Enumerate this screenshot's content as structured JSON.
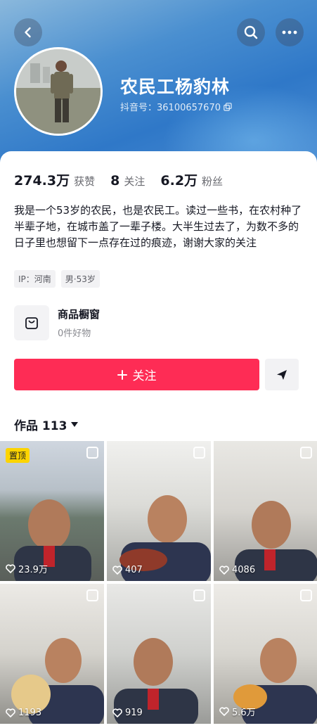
{
  "header": {
    "name": "农民工杨豹林",
    "douyin_id": "抖音号：36100657670"
  },
  "stats": [
    {
      "value": "274.3万",
      "label": "获赞"
    },
    {
      "value": "8",
      "label": "关注"
    },
    {
      "value": "6.2万",
      "label": "粉丝"
    }
  ],
  "bio": "我是一个53岁的农民，也是农民工。读过一些书，在农村种了半辈子地，在城市盖了一辈子楼。大半生过去了，为数不多的日子里也想留下一点存在过的痕迹，谢谢大家的关注",
  "tags": [
    "IP：河南",
    "男·53岁"
  ],
  "shop": {
    "title": "商品橱窗",
    "subtitle": "0件好物"
  },
  "follow_button": {
    "label": "关注"
  },
  "works_tab": {
    "label": "作品 113"
  },
  "videos": [
    {
      "likes": "23.9万",
      "pinned": "置顶"
    },
    {
      "likes": "407"
    },
    {
      "likes": "4086"
    },
    {
      "likes": "1193"
    },
    {
      "likes": "919"
    },
    {
      "likes": "5.6万"
    }
  ],
  "colors": {
    "accent": "#fe2c55",
    "pin": "#fcd400",
    "header": "#2f78c8"
  }
}
